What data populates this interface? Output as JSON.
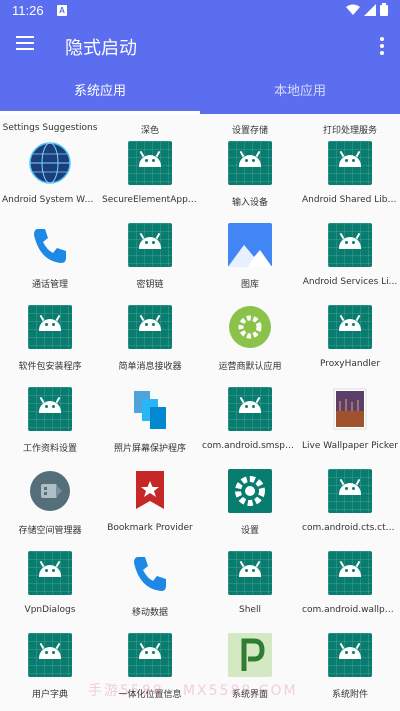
{
  "status_bar": {
    "time": "11:26",
    "notification_badge": "A"
  },
  "app_bar": {
    "title": "隐式启动"
  },
  "tabs": [
    {
      "label": "系统应用",
      "active": true
    },
    {
      "label": "本地应用",
      "active": false
    }
  ],
  "apps": [
    {
      "label": "Settings Suggestions",
      "icon": "android-icon"
    },
    {
      "label": "深色",
      "icon": "android-icon"
    },
    {
      "label": "设置存储",
      "icon": "android-icon"
    },
    {
      "label": "打印处理服务",
      "icon": "android-icon"
    },
    {
      "label": "Android System We...",
      "icon": "globe-icon"
    },
    {
      "label": "SecureElementAppl...",
      "icon": "android-icon"
    },
    {
      "label": "输入设备",
      "icon": "android-icon"
    },
    {
      "label": "Android Shared Libr...",
      "icon": "android-icon"
    },
    {
      "label": "通话管理",
      "icon": "phone-icon"
    },
    {
      "label": "密钥链",
      "icon": "android-icon"
    },
    {
      "label": "图库",
      "icon": "gallery-icon"
    },
    {
      "label": "Android Services Li...",
      "icon": "android-icon"
    },
    {
      "label": "软件包安装程序",
      "icon": "android-icon"
    },
    {
      "label": "简单消息接收器",
      "icon": "android-icon"
    },
    {
      "label": "运营商默认应用",
      "icon": "gear-icon"
    },
    {
      "label": "ProxyHandler",
      "icon": "android-icon"
    },
    {
      "label": "工作资料设置",
      "icon": "android-icon"
    },
    {
      "label": "照片屏幕保护程序",
      "icon": "photo-screensaver-icon"
    },
    {
      "label": "com.android.smspu...",
      "icon": "android-icon"
    },
    {
      "label": "Live Wallpaper Picker",
      "icon": "wallpaper-icon"
    },
    {
      "label": "存储空间管理器",
      "icon": "storage-icon"
    },
    {
      "label": "Bookmark Provider",
      "icon": "bookmark-icon"
    },
    {
      "label": "设置",
      "icon": "settings-icon"
    },
    {
      "label": "com.android.cts.cts...",
      "icon": "android-icon"
    },
    {
      "label": "VpnDialogs",
      "icon": "android-icon"
    },
    {
      "label": "移动数据",
      "icon": "phone-icon"
    },
    {
      "label": "Shell",
      "icon": "android-icon"
    },
    {
      "label": "com.android.wallpa...",
      "icon": "android-icon"
    },
    {
      "label": "用户字典",
      "icon": "android-icon"
    },
    {
      "label": "一体化位置信息",
      "icon": "android-icon"
    },
    {
      "label": "系统界面",
      "icon": "android-p-icon"
    },
    {
      "label": "系统附件",
      "icon": "android-icon"
    }
  ],
  "watermark": "手游5588 · MX5588.COM"
}
